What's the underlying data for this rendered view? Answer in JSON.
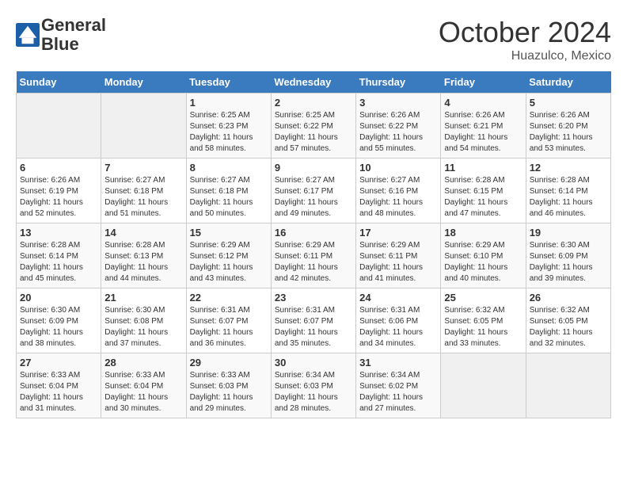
{
  "header": {
    "logo_line1": "General",
    "logo_line2": "Blue",
    "month": "October 2024",
    "location": "Huazulco, Mexico"
  },
  "weekdays": [
    "Sunday",
    "Monday",
    "Tuesday",
    "Wednesday",
    "Thursday",
    "Friday",
    "Saturday"
  ],
  "weeks": [
    [
      {
        "day": "",
        "sunrise": "",
        "sunset": "",
        "daylight": ""
      },
      {
        "day": "",
        "sunrise": "",
        "sunset": "",
        "daylight": ""
      },
      {
        "day": "1",
        "sunrise": "Sunrise: 6:25 AM",
        "sunset": "Sunset: 6:23 PM",
        "daylight": "Daylight: 11 hours and 58 minutes."
      },
      {
        "day": "2",
        "sunrise": "Sunrise: 6:25 AM",
        "sunset": "Sunset: 6:22 PM",
        "daylight": "Daylight: 11 hours and 57 minutes."
      },
      {
        "day": "3",
        "sunrise": "Sunrise: 6:26 AM",
        "sunset": "Sunset: 6:22 PM",
        "daylight": "Daylight: 11 hours and 55 minutes."
      },
      {
        "day": "4",
        "sunrise": "Sunrise: 6:26 AM",
        "sunset": "Sunset: 6:21 PM",
        "daylight": "Daylight: 11 hours and 54 minutes."
      },
      {
        "day": "5",
        "sunrise": "Sunrise: 6:26 AM",
        "sunset": "Sunset: 6:20 PM",
        "daylight": "Daylight: 11 hours and 53 minutes."
      }
    ],
    [
      {
        "day": "6",
        "sunrise": "Sunrise: 6:26 AM",
        "sunset": "Sunset: 6:19 PM",
        "daylight": "Daylight: 11 hours and 52 minutes."
      },
      {
        "day": "7",
        "sunrise": "Sunrise: 6:27 AM",
        "sunset": "Sunset: 6:18 PM",
        "daylight": "Daylight: 11 hours and 51 minutes."
      },
      {
        "day": "8",
        "sunrise": "Sunrise: 6:27 AM",
        "sunset": "Sunset: 6:18 PM",
        "daylight": "Daylight: 11 hours and 50 minutes."
      },
      {
        "day": "9",
        "sunrise": "Sunrise: 6:27 AM",
        "sunset": "Sunset: 6:17 PM",
        "daylight": "Daylight: 11 hours and 49 minutes."
      },
      {
        "day": "10",
        "sunrise": "Sunrise: 6:27 AM",
        "sunset": "Sunset: 6:16 PM",
        "daylight": "Daylight: 11 hours and 48 minutes."
      },
      {
        "day": "11",
        "sunrise": "Sunrise: 6:28 AM",
        "sunset": "Sunset: 6:15 PM",
        "daylight": "Daylight: 11 hours and 47 minutes."
      },
      {
        "day": "12",
        "sunrise": "Sunrise: 6:28 AM",
        "sunset": "Sunset: 6:14 PM",
        "daylight": "Daylight: 11 hours and 46 minutes."
      }
    ],
    [
      {
        "day": "13",
        "sunrise": "Sunrise: 6:28 AM",
        "sunset": "Sunset: 6:14 PM",
        "daylight": "Daylight: 11 hours and 45 minutes."
      },
      {
        "day": "14",
        "sunrise": "Sunrise: 6:28 AM",
        "sunset": "Sunset: 6:13 PM",
        "daylight": "Daylight: 11 hours and 44 minutes."
      },
      {
        "day": "15",
        "sunrise": "Sunrise: 6:29 AM",
        "sunset": "Sunset: 6:12 PM",
        "daylight": "Daylight: 11 hours and 43 minutes."
      },
      {
        "day": "16",
        "sunrise": "Sunrise: 6:29 AM",
        "sunset": "Sunset: 6:11 PM",
        "daylight": "Daylight: 11 hours and 42 minutes."
      },
      {
        "day": "17",
        "sunrise": "Sunrise: 6:29 AM",
        "sunset": "Sunset: 6:11 PM",
        "daylight": "Daylight: 11 hours and 41 minutes."
      },
      {
        "day": "18",
        "sunrise": "Sunrise: 6:29 AM",
        "sunset": "Sunset: 6:10 PM",
        "daylight": "Daylight: 11 hours and 40 minutes."
      },
      {
        "day": "19",
        "sunrise": "Sunrise: 6:30 AM",
        "sunset": "Sunset: 6:09 PM",
        "daylight": "Daylight: 11 hours and 39 minutes."
      }
    ],
    [
      {
        "day": "20",
        "sunrise": "Sunrise: 6:30 AM",
        "sunset": "Sunset: 6:09 PM",
        "daylight": "Daylight: 11 hours and 38 minutes."
      },
      {
        "day": "21",
        "sunrise": "Sunrise: 6:30 AM",
        "sunset": "Sunset: 6:08 PM",
        "daylight": "Daylight: 11 hours and 37 minutes."
      },
      {
        "day": "22",
        "sunrise": "Sunrise: 6:31 AM",
        "sunset": "Sunset: 6:07 PM",
        "daylight": "Daylight: 11 hours and 36 minutes."
      },
      {
        "day": "23",
        "sunrise": "Sunrise: 6:31 AM",
        "sunset": "Sunset: 6:07 PM",
        "daylight": "Daylight: 11 hours and 35 minutes."
      },
      {
        "day": "24",
        "sunrise": "Sunrise: 6:31 AM",
        "sunset": "Sunset: 6:06 PM",
        "daylight": "Daylight: 11 hours and 34 minutes."
      },
      {
        "day": "25",
        "sunrise": "Sunrise: 6:32 AM",
        "sunset": "Sunset: 6:05 PM",
        "daylight": "Daylight: 11 hours and 33 minutes."
      },
      {
        "day": "26",
        "sunrise": "Sunrise: 6:32 AM",
        "sunset": "Sunset: 6:05 PM",
        "daylight": "Daylight: 11 hours and 32 minutes."
      }
    ],
    [
      {
        "day": "27",
        "sunrise": "Sunrise: 6:33 AM",
        "sunset": "Sunset: 6:04 PM",
        "daylight": "Daylight: 11 hours and 31 minutes."
      },
      {
        "day": "28",
        "sunrise": "Sunrise: 6:33 AM",
        "sunset": "Sunset: 6:04 PM",
        "daylight": "Daylight: 11 hours and 30 minutes."
      },
      {
        "day": "29",
        "sunrise": "Sunrise: 6:33 AM",
        "sunset": "Sunset: 6:03 PM",
        "daylight": "Daylight: 11 hours and 29 minutes."
      },
      {
        "day": "30",
        "sunrise": "Sunrise: 6:34 AM",
        "sunset": "Sunset: 6:03 PM",
        "daylight": "Daylight: 11 hours and 28 minutes."
      },
      {
        "day": "31",
        "sunrise": "Sunrise: 6:34 AM",
        "sunset": "Sunset: 6:02 PM",
        "daylight": "Daylight: 11 hours and 27 minutes."
      },
      {
        "day": "",
        "sunrise": "",
        "sunset": "",
        "daylight": ""
      },
      {
        "day": "",
        "sunrise": "",
        "sunset": "",
        "daylight": ""
      }
    ]
  ]
}
